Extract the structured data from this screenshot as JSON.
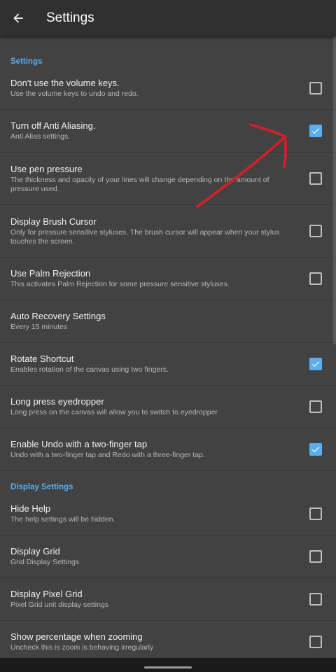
{
  "header": {
    "title": "Settings"
  },
  "sections": [
    {
      "title": "Settings",
      "items": [
        {
          "title": "Don't use the volume keys.",
          "subtitle": "Use the volume keys to undo and redo.",
          "checked": false
        },
        {
          "title": "Turn off Anti Aliasing.",
          "subtitle": "Anti Alias settings.",
          "checked": true
        },
        {
          "title": "Use pen pressure",
          "subtitle": "The thickness and opacity of your lines will change depending on the amount of pressure used.",
          "checked": false
        },
        {
          "title": "Display Brush Cursor",
          "subtitle": "Only for pressure sensitive styluses. The brush cursor will appear when your stylus touches the screen.",
          "checked": false
        },
        {
          "title": "Use Palm Rejection",
          "subtitle": "This activates Palm Rejection for some pressure sensitive styluses.",
          "checked": false
        },
        {
          "title": "Auto Recovery Settings",
          "subtitle": "Every 15 minutes",
          "checked": null
        },
        {
          "title": "Rotate Shortcut",
          "subtitle": "Enables rotation of the canvas using two fingers.",
          "checked": true
        },
        {
          "title": "Long press eyedropper",
          "subtitle": "Long press on the canvas will allow you to switch to eyedropper",
          "checked": false
        },
        {
          "title": "Enable Undo with a two-finger tap",
          "subtitle": "Undo with a two-finger tap and Redo with a three-finger tap.",
          "checked": true
        }
      ]
    },
    {
      "title": "Display Settings",
      "items": [
        {
          "title": "Hide Help",
          "subtitle": "The help settings will be hidden.",
          "checked": false
        },
        {
          "title": "Display Grid",
          "subtitle": "Grid Display Settings",
          "checked": false
        },
        {
          "title": "Display Pixel Grid",
          "subtitle": "Pixel Grid unit display settings",
          "checked": false
        },
        {
          "title": "Show percentage when zooming",
          "subtitle": "Uncheck this is zoom is behaving irregularly",
          "checked": false
        }
      ]
    }
  ],
  "colors": {
    "accent": "#5aaef0",
    "annotation": "#c8232a",
    "background": "#424242",
    "appbar": "#303030"
  },
  "icons": {
    "back": "arrow-back-icon",
    "check": "check-icon"
  }
}
